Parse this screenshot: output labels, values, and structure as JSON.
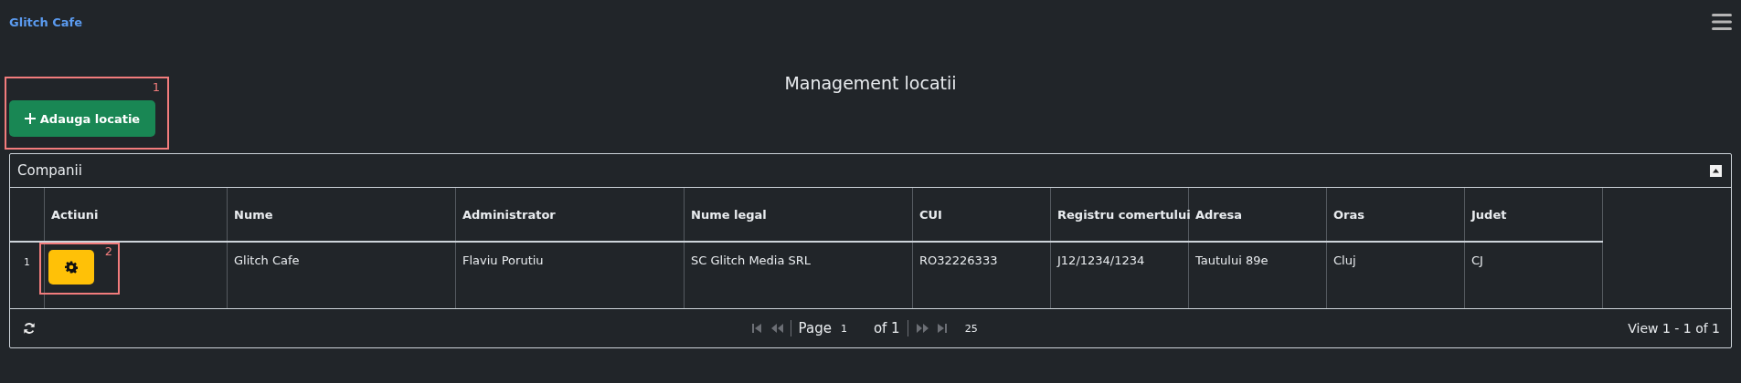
{
  "brand": "Glitch Cafe",
  "title": "Management locatii",
  "add_button": {
    "label": "Adauga locatie",
    "annotation": "1"
  },
  "panel": {
    "title": "Companii",
    "columns": [
      "Actiuni",
      "Nume",
      "Administrator",
      "Nume legal",
      "CUI",
      "Registru comertului",
      "Adresa",
      "Oras",
      "Judet"
    ],
    "rows": [
      {
        "row_number": "1",
        "action_annotation": "2",
        "cells": [
          "",
          "Glitch Cafe",
          "Flaviu Porutiu",
          "SC Glitch Media SRL",
          "RO32226333",
          "J12/1234/1234",
          "Tautului 89e",
          "Cluj",
          "CJ"
        ]
      }
    ],
    "pager": {
      "nav_before": [
        {
          "kind": "first",
          "disabled": true
        },
        {
          "kind": "prev",
          "disabled": true
        }
      ],
      "page_label": "Page",
      "page": "1",
      "of_label": "of 1",
      "nav_after": [
        {
          "kind": "next",
          "disabled": true
        },
        {
          "kind": "last",
          "disabled": true
        }
      ],
      "page_size": "25",
      "view": "View 1 - 1 of 1"
    }
  }
}
